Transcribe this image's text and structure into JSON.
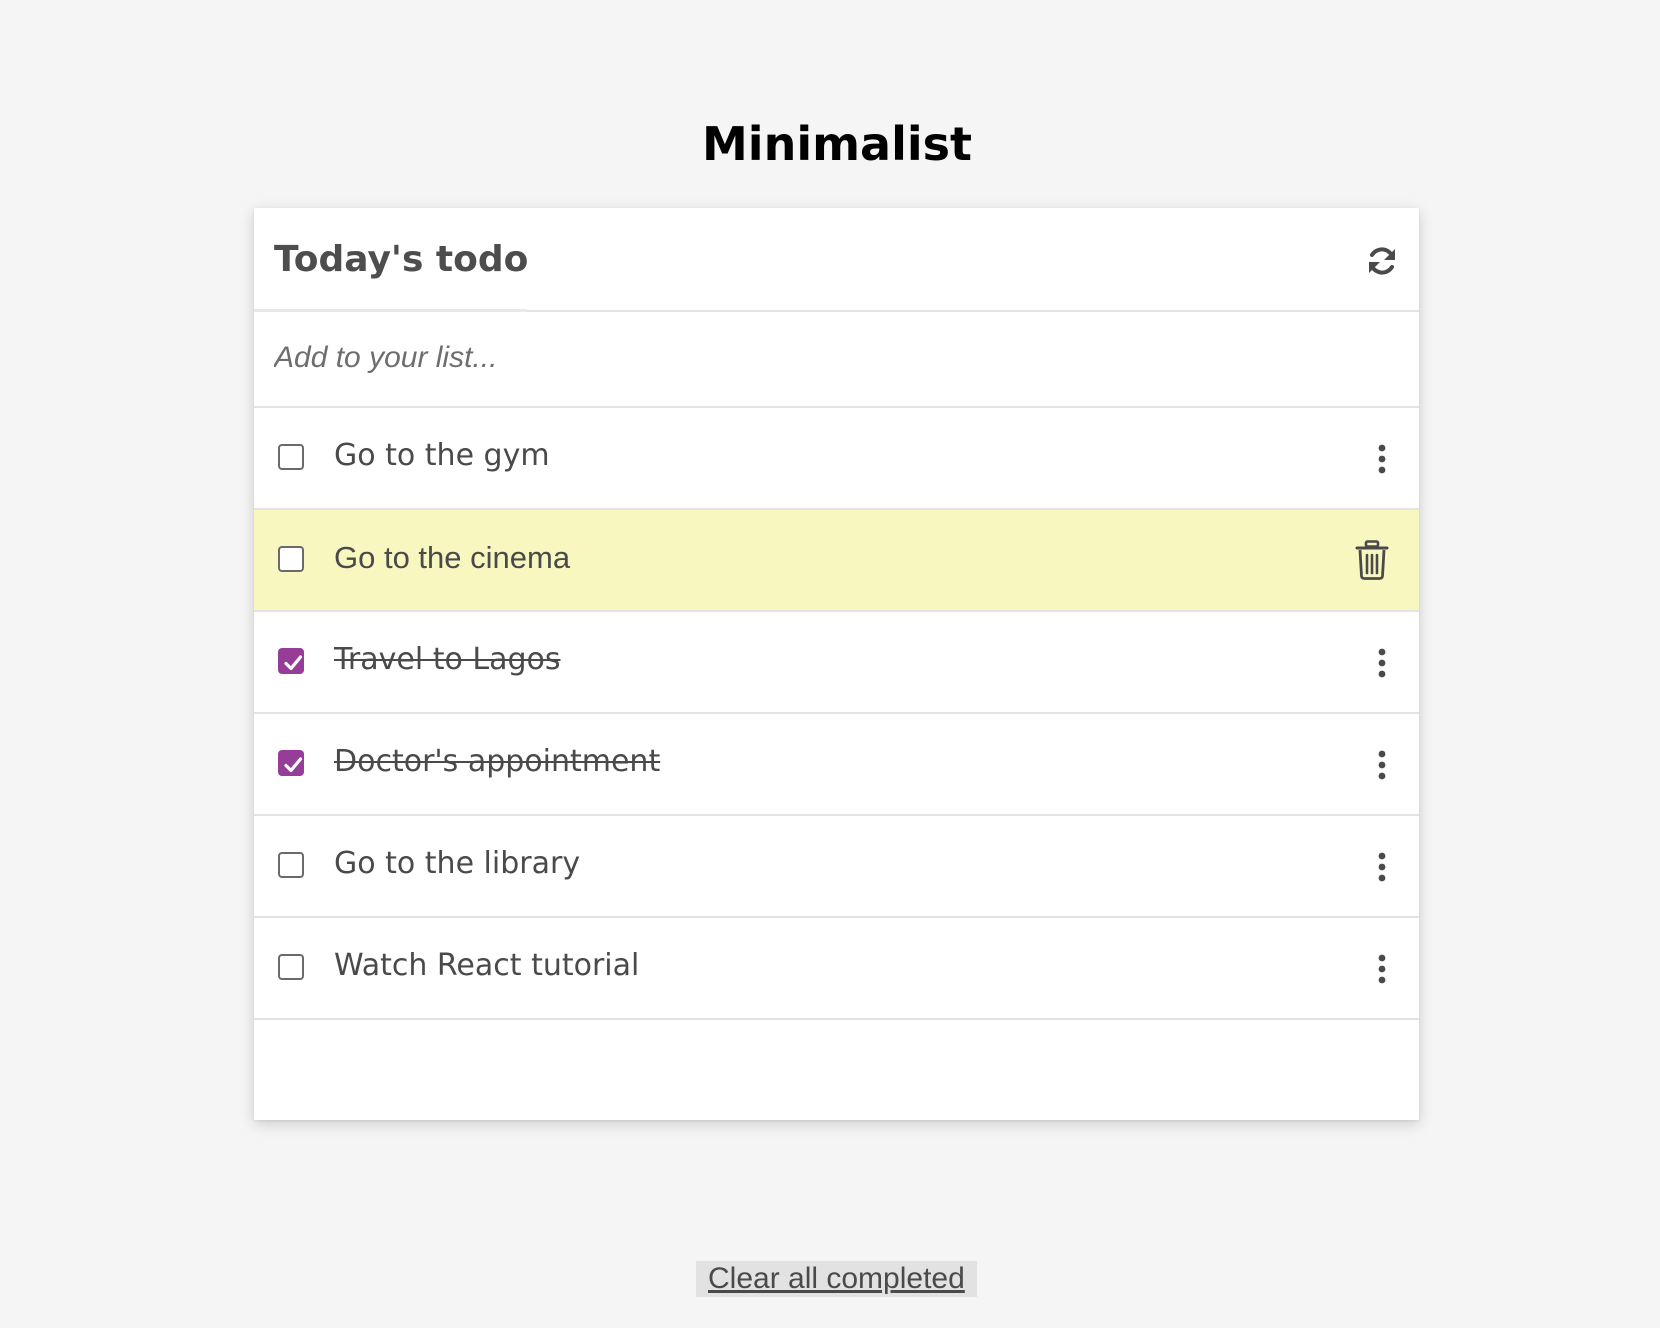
{
  "app": {
    "title": "Minimalist"
  },
  "card": {
    "title": "Today's todo",
    "refresh_icon": "refresh-icon"
  },
  "add": {
    "placeholder": "Add to your list...",
    "value": ""
  },
  "todos": [
    {
      "label": "Go to the gym",
      "completed": false,
      "highlighted": false,
      "action_icon": "more-vertical-icon"
    },
    {
      "label": "Go to the cinema",
      "completed": false,
      "highlighted": true,
      "action_icon": "trash-icon"
    },
    {
      "label": "Travel to Lagos",
      "completed": true,
      "highlighted": false,
      "action_icon": "more-vertical-icon"
    },
    {
      "label": "Doctor's appointment",
      "completed": true,
      "highlighted": false,
      "action_icon": "more-vertical-icon"
    },
    {
      "label": "Go to the library",
      "completed": false,
      "highlighted": false,
      "action_icon": "more-vertical-icon"
    },
    {
      "label": "Watch React tutorial",
      "completed": false,
      "highlighted": false,
      "action_icon": "more-vertical-icon"
    }
  ],
  "footer": {
    "clear_label": "Clear all completed"
  },
  "colors": {
    "page_bg": "#f5f5f5",
    "card_bg": "#ffffff",
    "highlight_bg": "#f8f7c0",
    "checkbox_checked": "#963d97",
    "text": "#4a4a4a",
    "title": "#000000"
  }
}
